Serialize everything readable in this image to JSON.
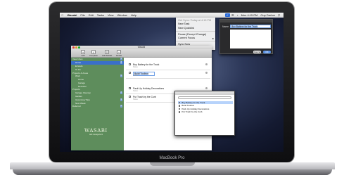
{
  "device_label": "MacBook Pro",
  "menubar": {
    "app_name": "Wasabi",
    "items": [
      "File",
      "Edit",
      "Tasks",
      "View",
      "Window",
      "Help"
    ],
    "right_items": [
      "Mon 4:15 PM",
      "Guy Dreher"
    ]
  },
  "status_menu": {
    "header": "Get Sync: Today at 4:15 PM",
    "items": [
      {
        "label": "New Task",
        "dim": false
      },
      {
        "label": "New Quicklist",
        "dim": false
      },
      {
        "label": "Pause (Except Change)",
        "dim": false
      },
      {
        "label": "Current Focus",
        "dim": false,
        "submenu": true
      },
      {
        "label": "Sync Now",
        "dim": false
      }
    ]
  },
  "quick_entry": {
    "name_label": "Name",
    "name_value": "Buy Battery for the Truck",
    "cancel_label": "Cancel",
    "ok_label": "OK"
  },
  "main_window": {
    "title": "Wasabi",
    "toolbar": [
      {
        "label": "Add",
        "icon": "plus-icon"
      },
      {
        "label": "Complete",
        "icon": "check-icon"
      },
      {
        "label": "Add Sublist",
        "icon": "list-icon"
      },
      {
        "label": "Delete",
        "icon": "minus-icon"
      }
    ],
    "sidebar": [
      {
        "label": "View Inbox",
        "level": 0,
        "count": "3"
      },
      {
        "label": "Home",
        "level": 1,
        "count": "4",
        "selected": true
      },
      {
        "label": "Errands",
        "level": 1,
        "count": ""
      },
      {
        "label": "To Do",
        "level": 1,
        "count": ""
      },
      {
        "label": "Projects & Areas",
        "level": 0,
        "count": ""
      },
      {
        "label": "Work",
        "level": 1,
        "count": "5"
      },
      {
        "label": "Home",
        "level": 2,
        "count": ""
      },
      {
        "label": "Garage",
        "level": 2,
        "count": ""
      },
      {
        "label": "Declutter",
        "level": 2,
        "count": ""
      },
      {
        "label": "Projects",
        "level": 0,
        "count": ""
      },
      {
        "label": "Garage Cleanup",
        "level": 1,
        "count": "2"
      },
      {
        "label": "Garden",
        "level": 1,
        "count": ""
      },
      {
        "label": "Upcoming Trips",
        "level": 1,
        "count": "3"
      },
      {
        "label": "Next Week",
        "level": 1,
        "count": ""
      },
      {
        "label": "Deferred",
        "level": 0,
        "count": "2"
      }
    ],
    "logo": "WASABI",
    "logo_sub": "task management",
    "tasks": [
      {
        "name": "Buy Battery for the Truck",
        "notes": "Notes",
        "editing": false
      },
      {
        "name": "Build Toolbox",
        "notes": "Notes",
        "editing": true
      },
      {
        "name": "Pack Up Holiday Decorations",
        "notes": "Notes",
        "editing": false
      },
      {
        "name": "Put Trash by the Curb",
        "notes": "Notes",
        "editing": false
      }
    ]
  },
  "list_popup": {
    "items": [
      {
        "label": "Buy Battery for the Truck",
        "selected": true
      },
      {
        "label": "Build Toolbox",
        "selected": false
      },
      {
        "label": "Pack Up Holiday Decorations",
        "selected": false
      },
      {
        "label": "Put Trash by the Curb",
        "selected": false
      }
    ]
  },
  "colors": {
    "sidebar_bg": "#5e8d5c",
    "selection_blue": "#3a6fc8",
    "desktop": "#2c3758"
  }
}
